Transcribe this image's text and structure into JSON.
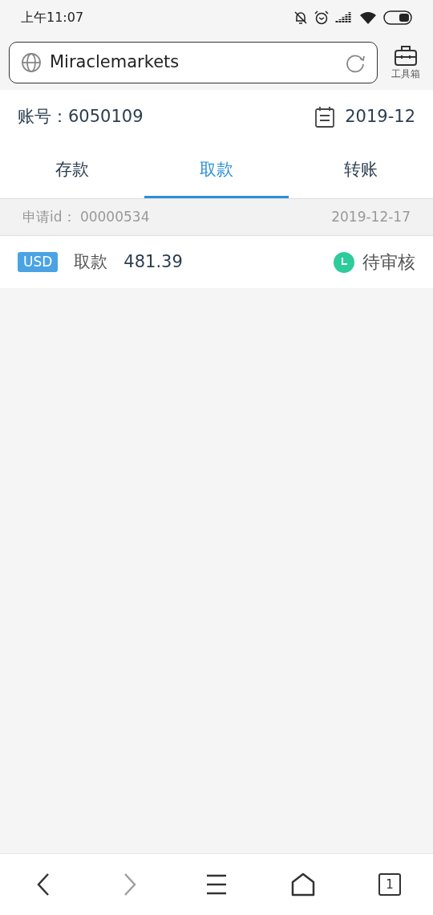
{
  "status_bar": {
    "time": "上午11:07"
  },
  "address_bar": {
    "value": "Miraclemarkets"
  },
  "toolbox": {
    "label": "工具箱"
  },
  "account": {
    "label": "账号：",
    "number": "6050109",
    "month": "2019-12"
  },
  "tabs": [
    {
      "label": "存款",
      "selected": false
    },
    {
      "label": "取款",
      "selected": true
    },
    {
      "label": "转账",
      "selected": false
    }
  ],
  "records": [
    {
      "id_label": "申请id：",
      "id": "00000534",
      "date": "2019-12-17",
      "currency": "USD",
      "type": "取款",
      "amount": "481.39",
      "status": "待审核",
      "color": "#2ecc9a"
    }
  ],
  "nav": [
    {
      "kind": "back",
      "disabled": false
    },
    {
      "kind": "forward",
      "disabled": true
    },
    {
      "kind": "menu",
      "disabled": false
    },
    {
      "kind": "home",
      "disabled": false
    },
    {
      "kind": "tabs",
      "disabled": false,
      "count": "1"
    }
  ]
}
